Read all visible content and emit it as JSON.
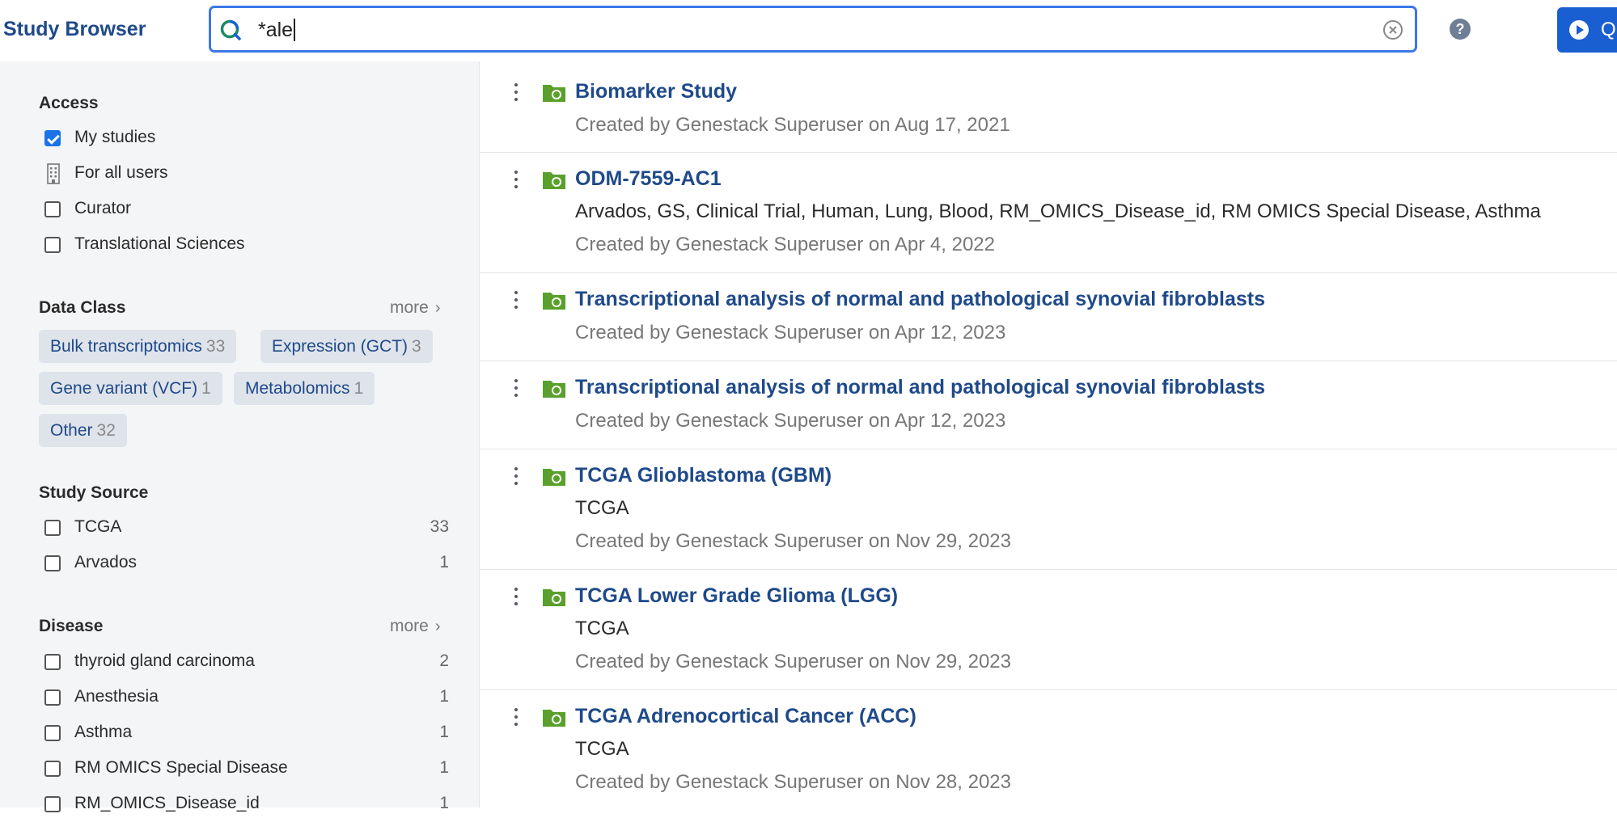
{
  "header": {
    "app_title": "Study Browser",
    "search_value": "*ale",
    "action_label": "Q"
  },
  "sidebar": {
    "access": {
      "title": "Access",
      "items": [
        {
          "label": "My studies",
          "checked": true
        },
        {
          "label": "For all users",
          "icon": "building-icon"
        },
        {
          "label": "Curator",
          "checked": false
        },
        {
          "label": "Translational Sciences",
          "checked": false
        }
      ]
    },
    "data_class": {
      "title": "Data Class",
      "more": "more",
      "chips": [
        {
          "label": "Bulk transcriptomics",
          "count": "33"
        },
        {
          "label": "Expression (GCT)",
          "count": "3"
        },
        {
          "label": "Gene variant (VCF)",
          "count": "1"
        },
        {
          "label": "Metabolomics",
          "count": "1"
        },
        {
          "label": "Other",
          "count": "32"
        }
      ]
    },
    "study_source": {
      "title": "Study Source",
      "items": [
        {
          "label": "TCGA",
          "count": "33",
          "checked": false
        },
        {
          "label": "Arvados",
          "count": "1",
          "checked": false
        }
      ]
    },
    "disease": {
      "title": "Disease",
      "more": "more",
      "items": [
        {
          "label": "thyroid gland carcinoma",
          "count": "2",
          "checked": false
        },
        {
          "label": "Anesthesia",
          "count": "1",
          "checked": false
        },
        {
          "label": "Asthma",
          "count": "1",
          "checked": false
        },
        {
          "label": "RM OMICS Special Disease",
          "count": "1",
          "checked": false
        },
        {
          "label": "RM_OMICS_Disease_id",
          "count": "1",
          "checked": false
        }
      ]
    }
  },
  "results": [
    {
      "title": "Biomarker Study",
      "tags": "",
      "meta": "Created by Genestack Superuser on Aug 17, 2021"
    },
    {
      "title": "ODM-7559-AC1",
      "tags": "Arvados, GS, Clinical Trial, Human, Lung, Blood, RM_OMICS_Disease_id, RM OMICS Special Disease, Asthma",
      "meta": "Created by Genestack Superuser on Apr 4, 2022"
    },
    {
      "title": "Transcriptional analysis of normal and pathological synovial fibroblasts",
      "tags": "",
      "meta": "Created by Genestack Superuser on Apr 12, 2023"
    },
    {
      "title": "Transcriptional analysis of normal and pathological synovial fibroblasts",
      "tags": "",
      "meta": "Created by Genestack Superuser on Apr 12, 2023"
    },
    {
      "title": "TCGA Glioblastoma (GBM)",
      "tags": "TCGA",
      "meta": "Created by Genestack Superuser on Nov 29, 2023"
    },
    {
      "title": "TCGA Lower Grade Glioma (LGG)",
      "tags": "TCGA",
      "meta": "Created by Genestack Superuser on Nov 29, 2023"
    },
    {
      "title": "TCGA Adrenocortical Cancer (ACC)",
      "tags": "TCGA",
      "meta": "Created by Genestack Superuser on Nov 28, 2023"
    }
  ],
  "colors": {
    "brand": "#1f4a8a",
    "accent": "#1a5fd2",
    "folder": "#5aa02c",
    "sidebar_bg": "#f4f5f7"
  }
}
